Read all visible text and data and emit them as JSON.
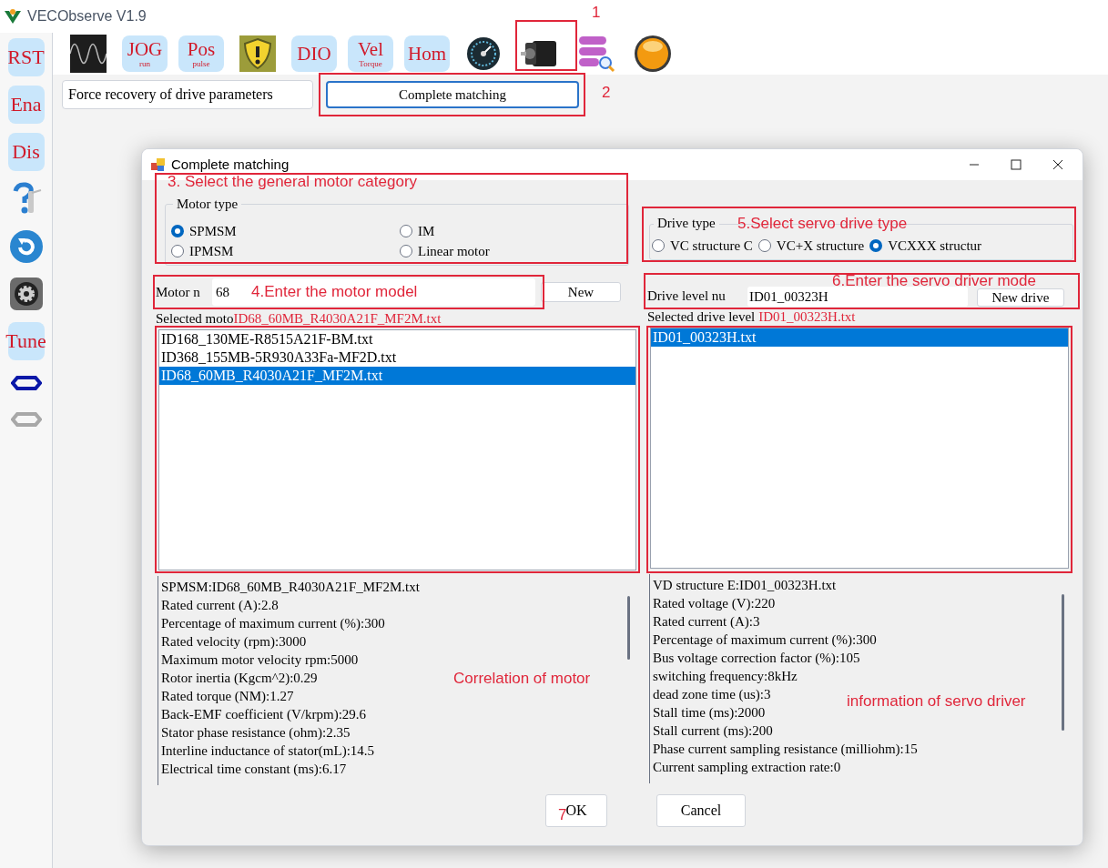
{
  "app": {
    "title": "VECObserve V1.9"
  },
  "sidebar": [
    {
      "kind": "label",
      "text": "RST"
    },
    {
      "kind": "label",
      "text": "Ena"
    },
    {
      "kind": "label",
      "text": "Dis"
    },
    {
      "kind": "help"
    },
    {
      "kind": "refresh"
    },
    {
      "kind": "gear"
    },
    {
      "kind": "label",
      "text": "Tune"
    },
    {
      "kind": "link",
      "disabled": false
    },
    {
      "kind": "link",
      "disabled": true
    }
  ],
  "toolbar": [
    {
      "kind": "waveform"
    },
    {
      "kind": "label",
      "text": "JOG",
      "sub": "run"
    },
    {
      "kind": "label",
      "text": "Pos",
      "sub": "pulse"
    },
    {
      "kind": "shield"
    },
    {
      "kind": "label",
      "text": "DIO"
    },
    {
      "kind": "label",
      "text": "Vel",
      "sub": "Torque"
    },
    {
      "kind": "label",
      "text": "Hom"
    },
    {
      "kind": "gauge"
    },
    {
      "kind": "motor"
    },
    {
      "kind": "database"
    },
    {
      "kind": "orb"
    }
  ],
  "recovery_label": "Force recovery of drive parameters",
  "matching_button": "Complete matching",
  "dialog": {
    "title": "Complete matching",
    "motor_type": {
      "legend": "Motor type",
      "options": [
        {
          "label": "SPMSM",
          "selected": true
        },
        {
          "label": "IM",
          "selected": false
        },
        {
          "label": "IPMSM",
          "selected": false
        },
        {
          "label": "Linear motor",
          "selected": false
        }
      ]
    },
    "drive_type": {
      "legend": "Drive type",
      "options": [
        {
          "label": "VC structure C",
          "selected": false
        },
        {
          "label": "VC+X structure",
          "selected": false
        },
        {
          "label": "VCXXX structur",
          "selected": true
        }
      ]
    },
    "motor_search": {
      "label": "Motor n",
      "value": "68",
      "button": "New"
    },
    "drive_search": {
      "label": "Drive level nu",
      "value": "ID01_00323H",
      "button": "New drive"
    },
    "selected_motor": {
      "label": "Selected moto",
      "value": "ID68_60MB_R4030A21F_MF2M.txt"
    },
    "selected_drive": {
      "label": "Selected drive level",
      "value": "ID01_00323H.txt"
    },
    "motor_files": [
      {
        "name": "ID168_130ME-R8515A21F-BM.txt",
        "selected": false
      },
      {
        "name": "ID368_155MB-5R930A33Fa-MF2D.txt",
        "selected": false
      },
      {
        "name": "ID68_60MB_R4030A21F_MF2M.txt",
        "selected": true
      }
    ],
    "drive_files": [
      {
        "name": "ID01_00323H.txt",
        "selected": true
      }
    ],
    "motor_info": [
      "SPMSM:ID68_60MB_R4030A21F_MF2M.txt",
      "Rated current (A):2.8",
      "Percentage of maximum current (%):300",
      "Rated velocity (rpm):3000",
      "Maximum motor velocity rpm:5000",
      "Rotor inertia (Kgcm^2):0.29",
      "Rated torque (NM):1.27",
      "Back-EMF coefficient (V/krpm):29.6",
      "Stator phase resistance (ohm):2.35",
      "Interline inductance of stator(mL):14.5",
      "Electrical time constant (ms):6.17"
    ],
    "drive_info": [
      "VD structure E:ID01_00323H.txt",
      "Rated voltage (V):220",
      "Rated current (A):3",
      "Percentage of maximum current (%):300",
      "Bus voltage correction factor (%):105",
      "switching frequency:8kHz",
      "dead zone time (us):3",
      "Stall time (ms):2000",
      "Stall current (ms):200",
      "Phase current sampling resistance (milliohm):15",
      "Current sampling extraction rate:0"
    ],
    "buttons": [
      "OK",
      "Cancel"
    ]
  },
  "annotations": [
    {
      "label": "1"
    },
    {
      "label": "2"
    },
    {
      "label": "3. Select the general motor category"
    },
    {
      "label": "4.Enter the motor model"
    },
    {
      "label": "5.Select servo drive type"
    },
    {
      "label": "6.Enter the servo driver mode"
    },
    {
      "label": "Correlation of motor"
    },
    {
      "label": "information of servo driver"
    },
    {
      "label": "7"
    }
  ]
}
